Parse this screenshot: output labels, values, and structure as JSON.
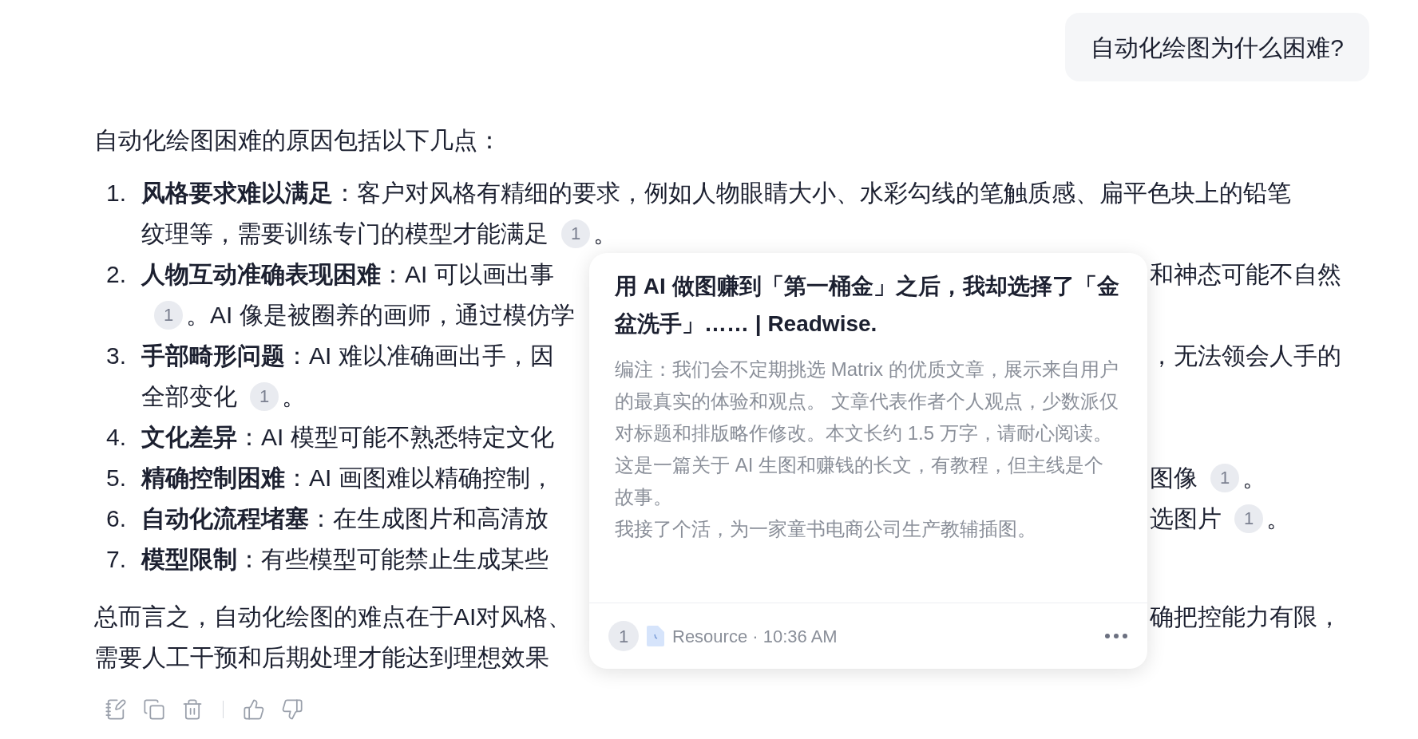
{
  "user_message": {
    "text": "自动化绘图为什么困难?"
  },
  "answer": {
    "intro": "自动化绘图困难的原因包括以下几点：",
    "items": [
      {
        "number": "1.",
        "lines": [
          {
            "segments": [
              {
                "kind": "text",
                "text": "**风格要求难以满足**：客户对风格有精细的要求，例如人物眼睛大小、水彩勾线的笔触质感、扁平色块上的铅笔"
              }
            ]
          },
          {
            "segments": [
              {
                "kind": "text",
                "text": "纹理等，需要训练专门的模型才能满足"
              },
              {
                "kind": "citation",
                "text": "1"
              },
              {
                "kind": "text",
                "text": "。"
              }
            ]
          }
        ]
      },
      {
        "number": "2.",
        "lines": [
          {
            "segments": [
              {
                "kind": "text",
                "text": "**人物互动准确表现困难**：AI 可以画出事"
              }
            ],
            "right": [
              {
                "kind": "text",
                "text": "和神态可能不自然"
              }
            ]
          },
          {
            "segments": [
              {
                "kind": "citation",
                "text": "1"
              },
              {
                "kind": "text",
                "text": "。AI 像是被圈养的画师，通过模仿学"
              }
            ]
          }
        ]
      },
      {
        "number": "3.",
        "lines": [
          {
            "segments": [
              {
                "kind": "text",
                "text": "**手部畸形问题**：AI 难以准确画出手，因"
              }
            ],
            "right": [
              {
                "kind": "text",
                "text": "，无法领会人手的"
              }
            ]
          },
          {
            "segments": [
              {
                "kind": "text",
                "text": "全部变化"
              },
              {
                "kind": "citation",
                "text": "1"
              },
              {
                "kind": "text",
                "text": "。"
              }
            ]
          }
        ]
      },
      {
        "number": "4.",
        "lines": [
          {
            "segments": [
              {
                "kind": "text",
                "text": "**文化差异**：AI 模型可能不熟悉特定文化"
              }
            ]
          }
        ]
      },
      {
        "number": "5.",
        "lines": [
          {
            "segments": [
              {
                "kind": "text",
                "text": "**精确控制困难**：AI 画图难以精确控制，"
              }
            ],
            "right": [
              {
                "kind": "text",
                "text": "图像"
              },
              {
                "kind": "citation",
                "text": "1"
              },
              {
                "kind": "text",
                "text": "。"
              }
            ]
          }
        ]
      },
      {
        "number": "6.",
        "lines": [
          {
            "segments": [
              {
                "kind": "text",
                "text": "**自动化流程堵塞**：在生成图片和高清放"
              }
            ],
            "right": [
              {
                "kind": "text",
                "text": "选图片"
              },
              {
                "kind": "citation",
                "text": "1"
              },
              {
                "kind": "text",
                "text": "。"
              }
            ]
          }
        ]
      },
      {
        "number": "7.",
        "lines": [
          {
            "segments": [
              {
                "kind": "text",
                "text": "**模型限制**：有些模型可能禁止生成某些"
              }
            ]
          }
        ]
      }
    ],
    "summary": [
      {
        "segments": [
          {
            "kind": "text",
            "text": "总而言之，自动化绘图的难点在于AI对风格、"
          }
        ],
        "right": [
          {
            "kind": "text",
            "text": "确把控能力有限，"
          }
        ]
      },
      {
        "segments": [
          {
            "kind": "text",
            "text": "需要人工干预和后期处理才能达到理想效果"
          }
        ]
      }
    ]
  },
  "actions": [
    {
      "kind": "note"
    },
    {
      "kind": "copy"
    },
    {
      "kind": "delete"
    },
    {
      "kind": "separator"
    },
    {
      "kind": "like"
    },
    {
      "kind": "dislike"
    }
  ],
  "popup": {
    "title": "用 AI 做图赚到「第一桶金」之后，我却选择了「金盆洗手」…… | Readwise.",
    "paragraphs": [
      "编注：我们会不定期挑选 Matrix 的优质文章，展示来自用户的最真实的体验和观点。 文章代表作者个人观点，少数派仅对标题和排版略作修改。本文长约 1.5 万字，请耐心阅读。",
      "这是一篇关于 AI 生图和赚钱的长文，有教程，但主线是个故事。",
      "我接了个活，为一家童书电商公司生产教辅插图。"
    ],
    "footer": {
      "citation": "1",
      "meta": "Resource · 10:36 AM"
    }
  }
}
